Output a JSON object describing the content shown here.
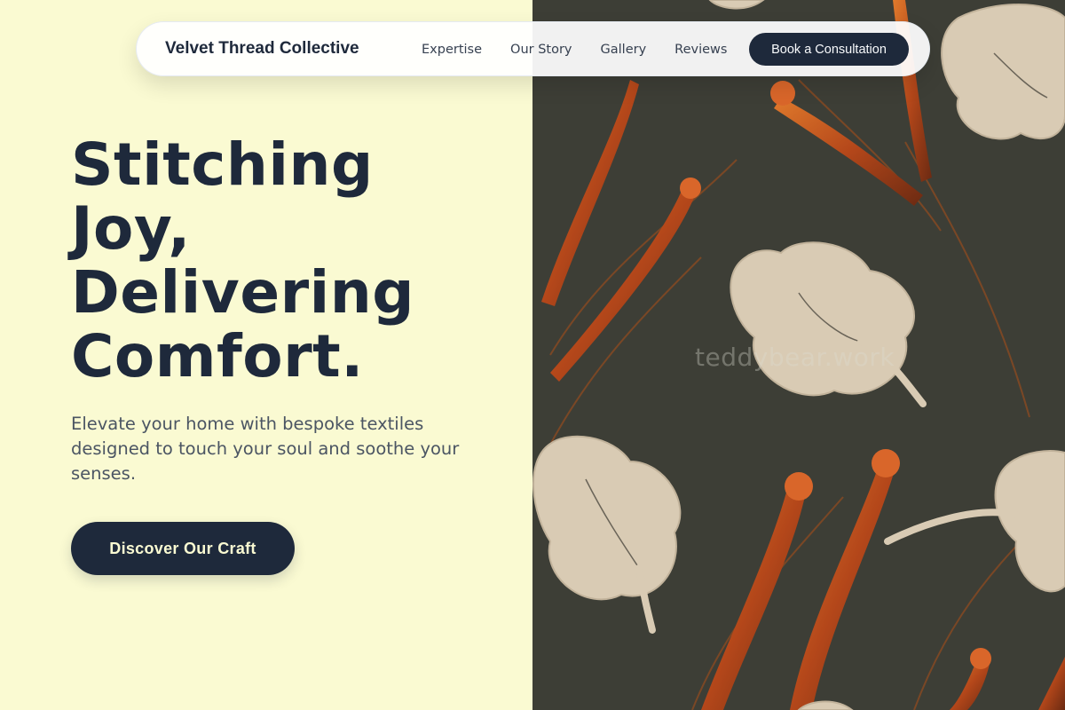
{
  "nav": {
    "brand": "Velvet Thread Collective",
    "links": [
      "Expertise",
      "Our Story",
      "Gallery",
      "Reviews"
    ],
    "cta_label": "Book a Consultation"
  },
  "hero": {
    "headline_lines": [
      "Stitching",
      "Joy,",
      "Delivering",
      "Comfort."
    ],
    "subtext": "Elevate your home with bespoke textiles designed to touch your soul and soothe your senses.",
    "cta_label": "Discover Our Craft"
  },
  "image": {
    "watermark": "teddybear.work"
  },
  "colors": {
    "page_bg": "#fafad2",
    "primary_dark": "#1e293b",
    "fabric_bg": "#3f3f38",
    "flower_orange": "#c2571b",
    "leaf_cream": "#d9cbb4"
  }
}
